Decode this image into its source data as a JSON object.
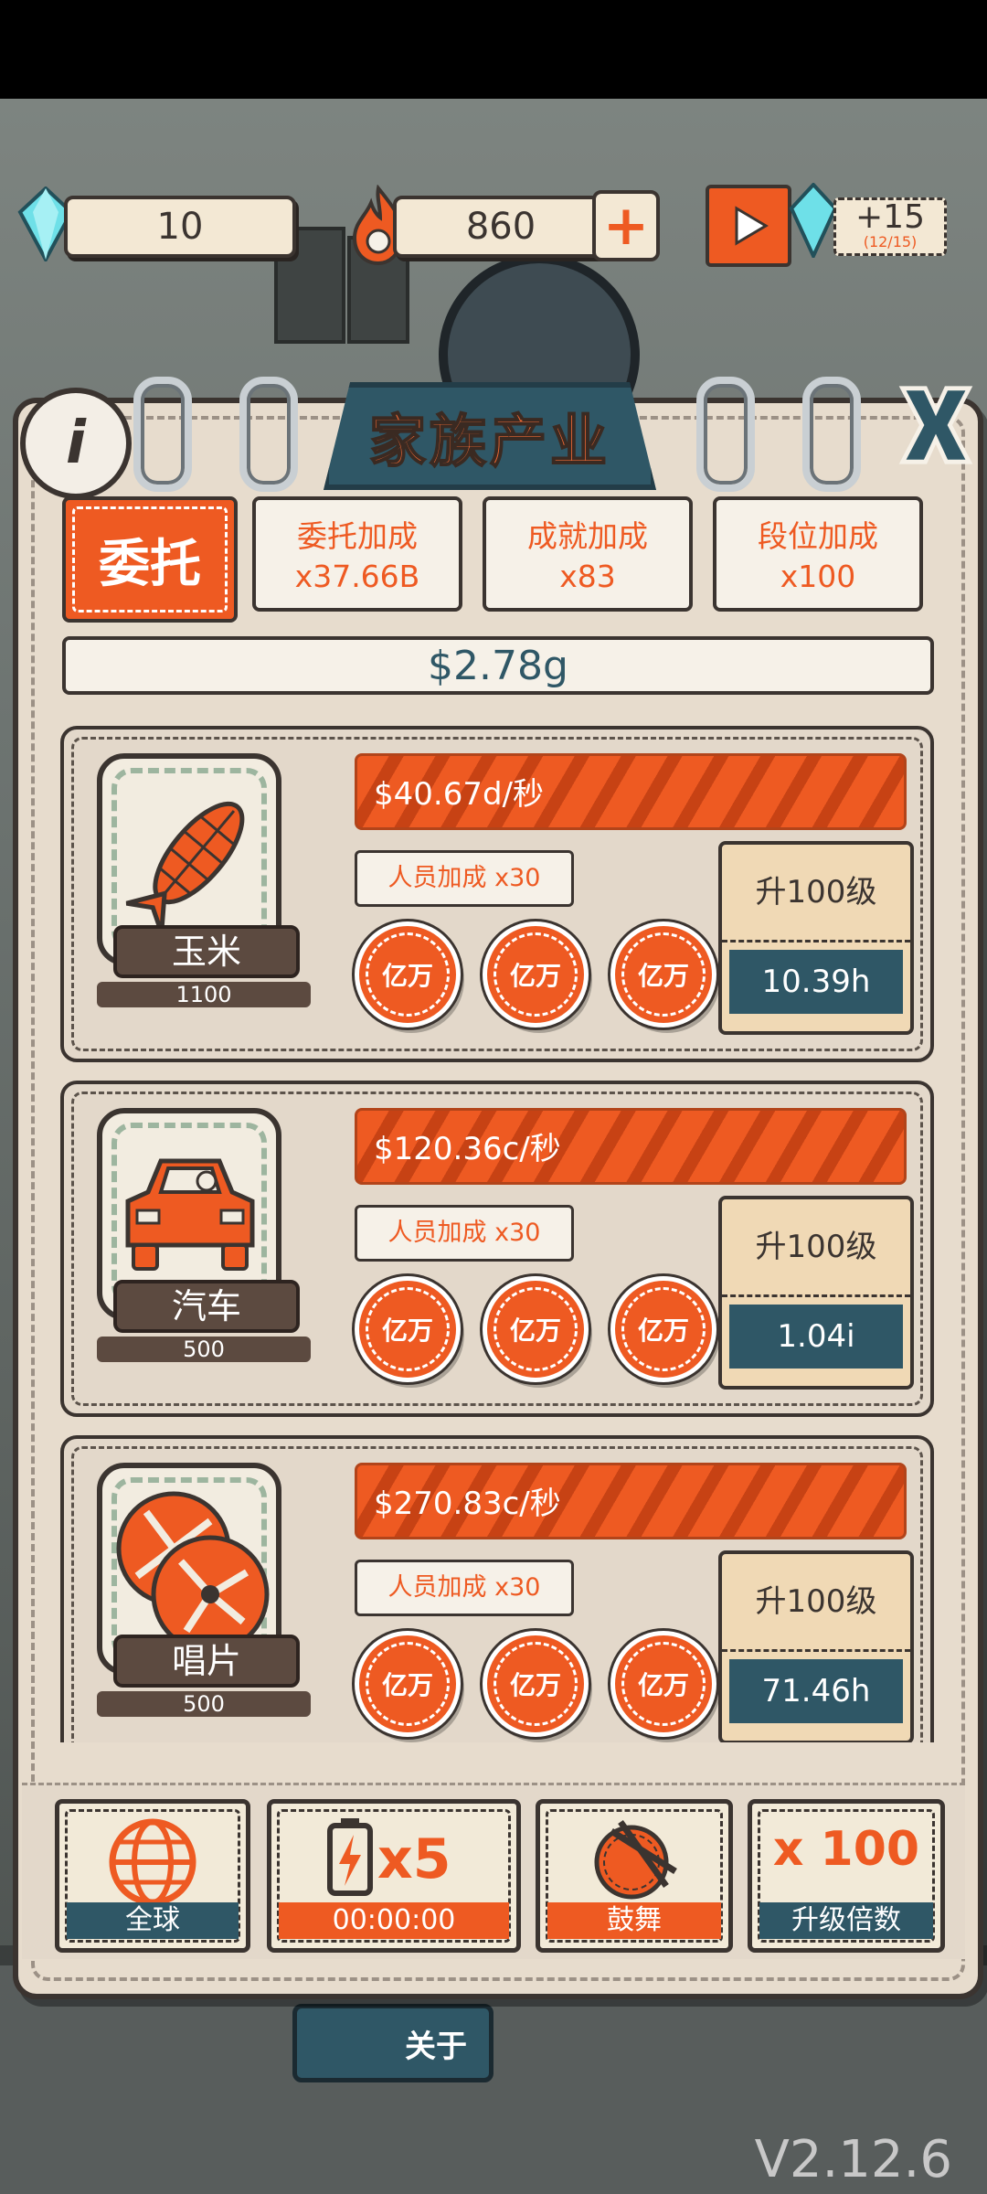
{
  "hud": {
    "gems": "10",
    "flames": "860",
    "video_reward": "+15",
    "video_count": "(12/15)"
  },
  "panel": {
    "title": "家族产业",
    "delegate_label": "委托",
    "boosts": [
      {
        "label": "委托加成",
        "value": "x37.66B"
      },
      {
        "label": "成就加成",
        "value": "x83"
      },
      {
        "label": "段位加成",
        "value": "x100"
      }
    ],
    "total_money": "$2.78g"
  },
  "industries": [
    {
      "name": "玉米",
      "level": "1100",
      "rate": "$40.67d/秒",
      "staff": "人员加成 x30",
      "coins": [
        "亿万",
        "亿万",
        "亿万"
      ],
      "upgrade_label": "升100级",
      "upgrade_time": "10.39h",
      "icon": "corn-icon"
    },
    {
      "name": "汽车",
      "level": "500",
      "rate": "$120.36c/秒",
      "staff": "人员加成 x30",
      "coins": [
        "亿万",
        "亿万",
        "亿万"
      ],
      "upgrade_label": "升100级",
      "upgrade_time": "1.04i",
      "icon": "car-icon"
    },
    {
      "name": "唱片",
      "level": "500",
      "rate": "$270.83c/秒",
      "staff": "人员加成 x30",
      "coins": [
        "亿万",
        "亿万",
        "亿万"
      ],
      "upgrade_label": "升100级",
      "upgrade_time": "71.46h",
      "icon": "record-icon"
    }
  ],
  "bottom": {
    "global": "全球",
    "battery_mult": "x5",
    "battery_timer": "00:00:00",
    "drum": "鼓舞",
    "multiplier": "x 100",
    "multiplier_label": "升级倍数"
  },
  "scene": {
    "sign": "关于",
    "version": "V2.12.6"
  },
  "colors": {
    "orange": "#ee5a22",
    "teal": "#2f5766",
    "cream": "#f6f1e8",
    "ink": "#3b3430"
  }
}
